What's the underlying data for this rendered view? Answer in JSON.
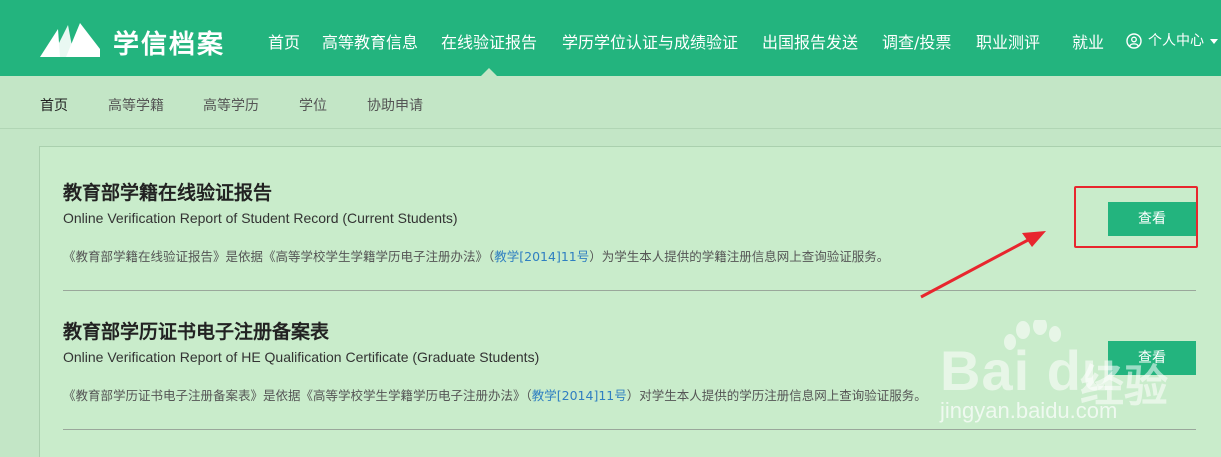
{
  "header": {
    "brand": "学信档案",
    "nav": [
      {
        "label": "首页"
      },
      {
        "label": "高等教育信息"
      },
      {
        "label": "在线验证报告"
      },
      {
        "label": "学历学位认证与成绩验证"
      },
      {
        "label": "出国报告发送"
      },
      {
        "label": "调查/投票"
      },
      {
        "label": "职业测评"
      },
      {
        "label": "就业"
      }
    ],
    "active_nav": "在线验证报告",
    "user_center": "个人中心"
  },
  "subnav": [
    {
      "label": "首页"
    },
    {
      "label": "高等学籍"
    },
    {
      "label": "高等学历"
    },
    {
      "label": "学位"
    },
    {
      "label": "协助申请"
    }
  ],
  "sections": [
    {
      "title": "教育部学籍在线验证报告",
      "subtitle": "Online Verification Report of Student Record (Current Students)",
      "desc_before": "《教育部学籍在线验证报告》是依据《高等学校学生学籍学历电子注册办法》（",
      "desc_link": "教学[2014]11号",
      "desc_after": "）为学生本人提供的学籍注册信息网上查询验证服务。",
      "button": "查看"
    },
    {
      "title": "教育部学历证书电子注册备案表",
      "subtitle": "Online Verification Report of HE Qualification Certificate (Graduate Students)",
      "desc_before": "《教育部学历证书电子注册备案表》是依据《高等学校学生学籍学历电子注册办法》（",
      "desc_link": "教学[2014]11号",
      "desc_after": "）对学生本人提供的学历注册信息网上查询验证服务。",
      "button": "查看"
    }
  ],
  "watermark": {
    "brand": "Bai du",
    "cn": "经验",
    "url": "jingyan.baidu.com"
  },
  "colors": {
    "header_bg": "#23b47e",
    "page_bg": "#c3e6c6",
    "button_bg": "#23b47e",
    "link": "#2f7fc1",
    "annotation_red": "#e8262e"
  }
}
